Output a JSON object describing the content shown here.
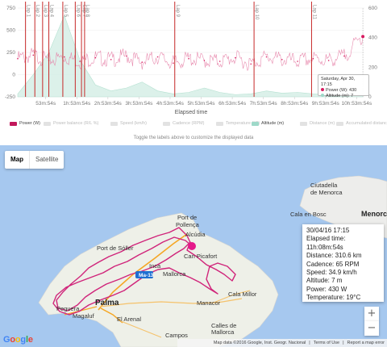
{
  "chart": {
    "x_axis_title": "Elapsed time",
    "x_ticks": [
      "53m:54s",
      "1h:53m:54s",
      "2h:53m:54s",
      "3h:53m:54s",
      "4h:53m:54s",
      "5h:53m:54s",
      "6h:53m:54s",
      "7h:53m:54s",
      "8h:53m:54s",
      "9h:53m:54s",
      "10h:53m:54s"
    ],
    "y_left_ticks": [
      "750",
      "500",
      "250",
      "0",
      "-250"
    ],
    "y_right_ticks": [
      "600",
      "400",
      "200",
      "0"
    ],
    "laps": [
      "Lap 1",
      "Lap 2",
      "Lap 3",
      "Lap 4",
      "Lap 5",
      "Lap 6",
      "Lap 7",
      "Lap 8",
      "Lap 9",
      "Lap 10",
      "Lap 11"
    ],
    "tooltip": {
      "time": "Saturday, Apr 30, 17:15",
      "power": "Power (W): 430",
      "altitude": "Altitude (m): 7"
    },
    "legend": [
      {
        "label": "Power (W)",
        "color": "#c2185b",
        "active": true
      },
      {
        "label": "Power balance (R/L %)",
        "color": "#e2e2e2",
        "active": false
      },
      {
        "label": "Speed (km/h)",
        "color": "#e2e2e2",
        "active": false
      },
      {
        "label": "Cadence (RPM)",
        "color": "#e2e2e2",
        "active": false
      },
      {
        "label": "Temperature (°C)",
        "color": "#e2e2e2",
        "active": false
      },
      {
        "label": "Altitude (m)",
        "color": "#9ed9c9",
        "active": true
      },
      {
        "label": "Distance (m)",
        "color": "#e2e2e2",
        "active": false
      },
      {
        "label": "Accumulated distance (km)",
        "color": "#e2e2e2",
        "active": false
      }
    ],
    "toggle_note": "Toggle the labels above to customize the displayed data"
  },
  "chart_data": {
    "type": "line",
    "xlabel": "Elapsed time",
    "x_unit": "hours",
    "series": [
      {
        "name": "Power (W)",
        "axis": "left",
        "color": "#d81b60",
        "x": [
          0,
          0.5,
          1,
          1.5,
          2,
          2.5,
          3,
          3.5,
          4,
          4.5,
          5,
          5.5,
          6,
          6.5,
          7,
          7.5,
          8,
          8.5,
          9,
          9.5,
          10,
          10.5,
          11.1
        ],
        "y": [
          180,
          220,
          160,
          200,
          150,
          190,
          170,
          210,
          140,
          200,
          130,
          180,
          160,
          150,
          190,
          120,
          200,
          170,
          150,
          180,
          160,
          210,
          430
        ]
      },
      {
        "name": "Altitude (m)",
        "axis": "right",
        "color": "#9ed9c9",
        "x": [
          0,
          0.5,
          1,
          1.5,
          2,
          2.5,
          3,
          3.5,
          4,
          4.5,
          5,
          5.5,
          6,
          6.5,
          7,
          7.5,
          8,
          8.5,
          9,
          9.5,
          10,
          10.5,
          11.1
        ],
        "y": [
          20,
          150,
          300,
          550,
          250,
          80,
          40,
          60,
          100,
          40,
          20,
          30,
          60,
          30,
          15,
          20,
          40,
          25,
          30,
          20,
          15,
          10,
          7
        ]
      }
    ],
    "lap_x": [
      0.25,
      0.55,
      0.8,
      1.0,
      1.45,
      1.85,
      2.05,
      2.15,
      5.05,
      7.6,
      9.45
    ],
    "ylim_left": [
      -250,
      750
    ],
    "ylim_right": [
      0,
      600
    ]
  },
  "map": {
    "map_label": "Map",
    "satellite_label": "Satellite",
    "places": {
      "pollenca": "Port de",
      "pollenca2": "Pollença",
      "alcudia": "Alcúdia",
      "can_picafort": "Can Picafort",
      "port_soller": "Port de Sóller",
      "inca": "Inca",
      "mallorca": "Mallorca",
      "manacor": "Manacor",
      "cala_millor": "Cala Millor",
      "palma": "Palma",
      "peguera": "Peguera",
      "magaluf": "Magaluf",
      "el_arenal": "El Arenal",
      "campos": "Campos",
      "calles": "Calles de",
      "calles2": "Mallorca",
      "ciutadella": "Ciutadella",
      "ciutadella2": "de Menorca",
      "cala_bosc": "Cala en Bosc",
      "menorca": "Menorca",
      "highway": "Ma-13"
    },
    "info": {
      "time": "30/04/16 17:15",
      "elapsed": "Elapsed time: 11h:08m:54s",
      "distance": "Distance: 310.6 km",
      "cadence": "Cadence: 65 RPM",
      "speed": "Speed: 34.9 km/h",
      "altitude": "Altitude: 7 m",
      "power": "Power: 430 W",
      "temperature": "Temperature: 19°C"
    },
    "zoom_in": "+",
    "zoom_out": "−",
    "google": [
      "G",
      "o",
      "o",
      "g",
      "l",
      "e"
    ],
    "google_colors": [
      "#4285f4",
      "#ea4335",
      "#fbbc05",
      "#4285f4",
      "#34a853",
      "#ea4335"
    ],
    "attribution": "Map data ©2016 Google, Inst. Geogr. Nacional",
    "terms": "Terms of Use",
    "report": "Report a map error"
  }
}
